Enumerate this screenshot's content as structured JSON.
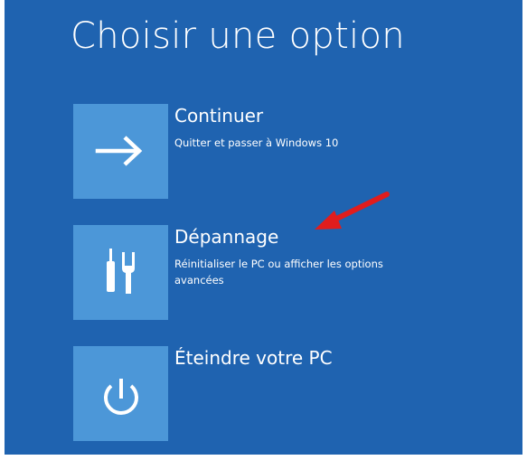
{
  "page": {
    "title": "Choisir une option"
  },
  "options": [
    {
      "title": "Continuer",
      "description": "Quitter et passer à Windows 10",
      "icon": "arrow-right-icon"
    },
    {
      "title": "Dépannage",
      "description": "Réinitialiser le PC ou afficher les options avancées",
      "icon": "tools-icon"
    },
    {
      "title": "Éteindre votre PC",
      "description": "",
      "icon": "power-icon"
    }
  ],
  "colors": {
    "background": "#1f63b0",
    "tile": "#4c97d8",
    "text": "#ffffff",
    "annotation_arrow": "#e01d1d"
  },
  "annotation": {
    "icon": "red-arrow-icon"
  }
}
